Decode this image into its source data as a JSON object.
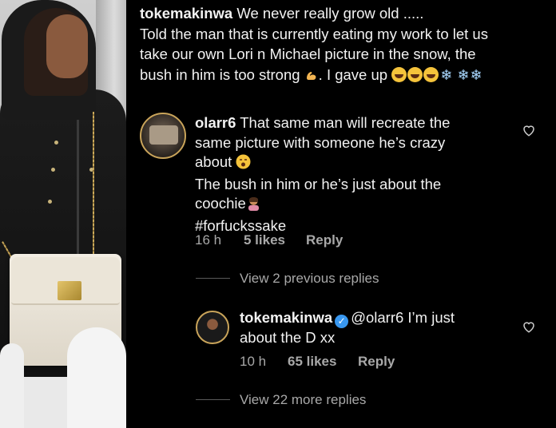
{
  "post": {
    "username": "tokemakinwa",
    "caption_line1": "We never really grow old .....",
    "caption_line2": "Told the man that is currently eating my work to let us",
    "caption_line3": "take our own Lori n Michael picture in the snow, the",
    "caption_line4": "bush in him is too strong",
    "caption_line4_end": ". I gave up"
  },
  "comment1": {
    "username": "olarr6",
    "line1": "That same man will recreate the",
    "line2": "same picture with someone he’s crazy",
    "line3": "about",
    "line4": "The bush in him or he’s just about the",
    "line5": "coochie",
    "line6": "#forfuckssake",
    "time": "16 h",
    "likes": "5 likes",
    "reply": "Reply"
  },
  "view_previous": "View 2 previous replies",
  "reply1": {
    "username": "tokemakinwa",
    "mention": "@olarr6",
    "line1": "I’m just",
    "line2": "about the D xx",
    "time": "10 h",
    "likes": "65 likes",
    "reply": "Reply"
  },
  "view_more": "View 22 more replies",
  "colors": {
    "background": "#000000",
    "text": "#f2f2f2",
    "muted": "#a8a8a8",
    "verified": "#3897f0",
    "story_ring": "#c9a45a"
  },
  "icons": [
    "muscle-emoji-icon",
    "laughing-emoji-icon",
    "snowflake-emoji-icon",
    "gasp-emoji-icon",
    "facepalm-emoji-icon",
    "heart-icon",
    "verified-icon"
  ]
}
